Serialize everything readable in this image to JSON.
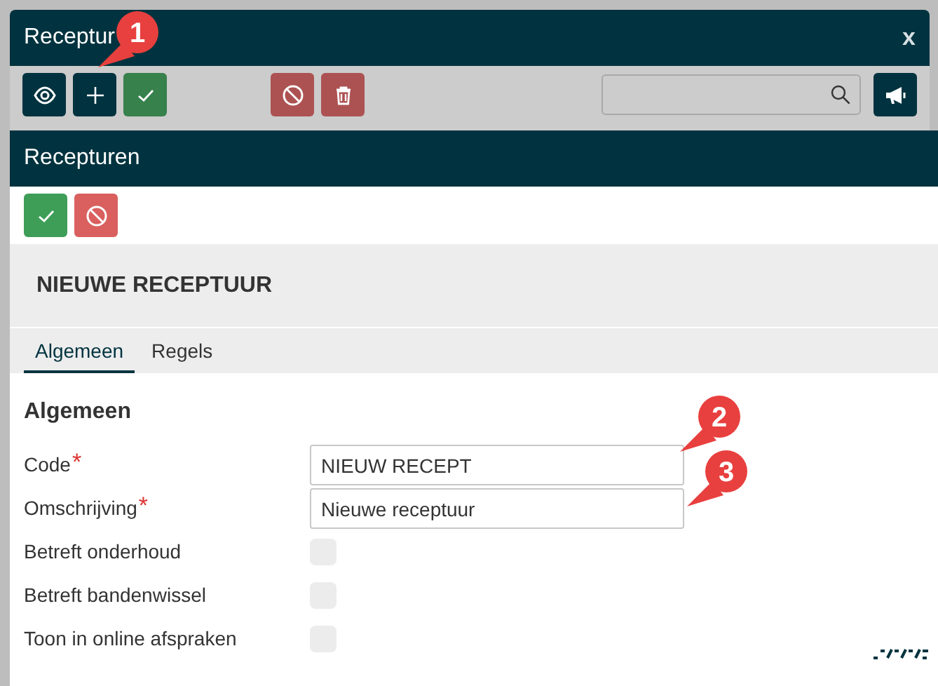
{
  "outer_window": {
    "title": "Receptur",
    "close": "x",
    "toolbar": [
      {
        "kind": "view"
      },
      {
        "kind": "add"
      },
      {
        "kind": "confirm"
      },
      {
        "kind": "cancel"
      },
      {
        "kind": "delete"
      }
    ]
  },
  "window": {
    "title": "Recepturen",
    "toolbar": [
      {
        "kind": "confirm"
      },
      {
        "kind": "cancel"
      }
    ],
    "heading": "NIEUWE RECEPTUUR",
    "tabs": [
      {
        "label": "Algemeen",
        "selected": true
      },
      {
        "label": "Regels",
        "selected": false
      }
    ],
    "section": "Algemeen",
    "fields": [
      {
        "kind": "text",
        "label": "Code",
        "required": true,
        "value": "NIEUW RECEPT"
      },
      {
        "kind": "text",
        "label": "Omschrijving",
        "required": true,
        "value": "Nieuwe receptuur"
      },
      {
        "kind": "checkbox",
        "label": "Betreft onderhoud",
        "checked": false
      },
      {
        "kind": "checkbox",
        "label": "Betreft bandenwissel",
        "checked": false
      },
      {
        "kind": "checkbox",
        "label": "Toon in online afspraken",
        "checked": false
      }
    ],
    "required_mark": "*"
  },
  "callouts": [
    {
      "label": "1"
    },
    {
      "label": "2"
    },
    {
      "label": "3"
    }
  ]
}
